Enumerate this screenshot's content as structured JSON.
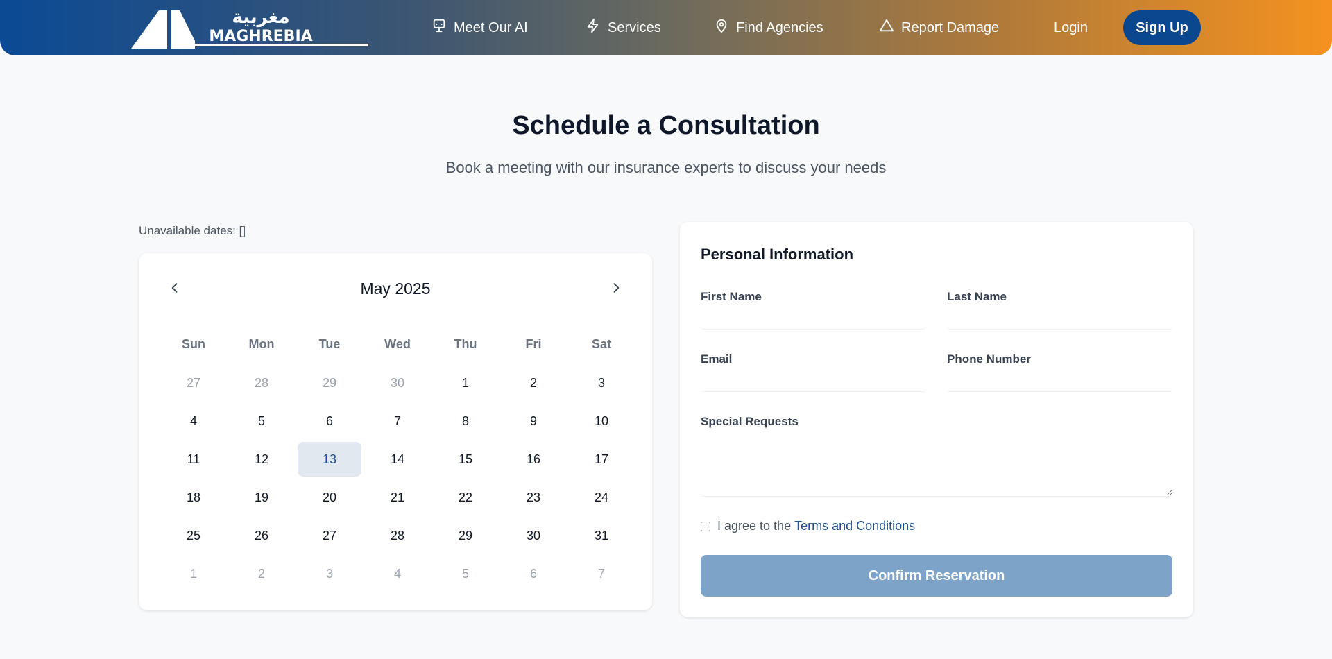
{
  "header": {
    "logo_text": "MAGHREBIA",
    "logo_arabic": "مغربية",
    "nav": [
      {
        "label": "Meet Our AI",
        "icon": "monitor-icon"
      },
      {
        "label": "Services",
        "icon": "lightning-icon"
      },
      {
        "label": "Find Agencies",
        "icon": "map-pin-icon"
      },
      {
        "label": "Report Damage",
        "icon": "warning-triangle-icon"
      }
    ],
    "login_label": "Login",
    "signup_label": "Sign Up"
  },
  "colors": {
    "brand_blue": "#0a478e",
    "brand_orange": "#f5921f",
    "link": "#1e4f91",
    "button_disabled": "#7ea3c8"
  },
  "page": {
    "title": "Schedule a Consultation",
    "subtitle": "Book a meeting with our insurance experts to discuss your needs",
    "unavailable_text": "Unavailable dates: []"
  },
  "calendar": {
    "month_label": "May 2025",
    "prev_icon": "chevron-left-icon",
    "next_icon": "chevron-right-icon",
    "weekdays": [
      "Sun",
      "Mon",
      "Tue",
      "Wed",
      "Thu",
      "Fri",
      "Sat"
    ],
    "selected_day": "13",
    "weeks": [
      [
        {
          "d": "27",
          "m": true
        },
        {
          "d": "28",
          "m": true
        },
        {
          "d": "29",
          "m": true
        },
        {
          "d": "30",
          "m": true
        },
        {
          "d": "1"
        },
        {
          "d": "2"
        },
        {
          "d": "3"
        }
      ],
      [
        {
          "d": "4"
        },
        {
          "d": "5"
        },
        {
          "d": "6"
        },
        {
          "d": "7"
        },
        {
          "d": "8"
        },
        {
          "d": "9"
        },
        {
          "d": "10"
        }
      ],
      [
        {
          "d": "11"
        },
        {
          "d": "12"
        },
        {
          "d": "13",
          "s": true
        },
        {
          "d": "14"
        },
        {
          "d": "15"
        },
        {
          "d": "16"
        },
        {
          "d": "17"
        }
      ],
      [
        {
          "d": "18"
        },
        {
          "d": "19"
        },
        {
          "d": "20"
        },
        {
          "d": "21"
        },
        {
          "d": "22"
        },
        {
          "d": "23"
        },
        {
          "d": "24"
        }
      ],
      [
        {
          "d": "25"
        },
        {
          "d": "26"
        },
        {
          "d": "27"
        },
        {
          "d": "28"
        },
        {
          "d": "29"
        },
        {
          "d": "30"
        },
        {
          "d": "31"
        }
      ],
      [
        {
          "d": "1",
          "m": true
        },
        {
          "d": "2",
          "m": true
        },
        {
          "d": "3",
          "m": true
        },
        {
          "d": "4",
          "m": true
        },
        {
          "d": "5",
          "m": true
        },
        {
          "d": "6",
          "m": true
        },
        {
          "d": "7",
          "m": true
        }
      ]
    ]
  },
  "form": {
    "title": "Personal Information",
    "first_name": {
      "label": "First Name",
      "value": "",
      "placeholder": ""
    },
    "last_name": {
      "label": "Last Name",
      "value": "",
      "placeholder": ""
    },
    "email": {
      "label": "Email",
      "value": "",
      "placeholder": ""
    },
    "phone": {
      "label": "Phone Number",
      "value": "",
      "placeholder": ""
    },
    "special_requests": {
      "label": "Special Requests",
      "value": "",
      "placeholder": ""
    },
    "terms_prefix": "I agree to the",
    "terms_link": "Terms and Conditions",
    "terms_checked": false,
    "confirm_label": "Confirm Reservation"
  }
}
